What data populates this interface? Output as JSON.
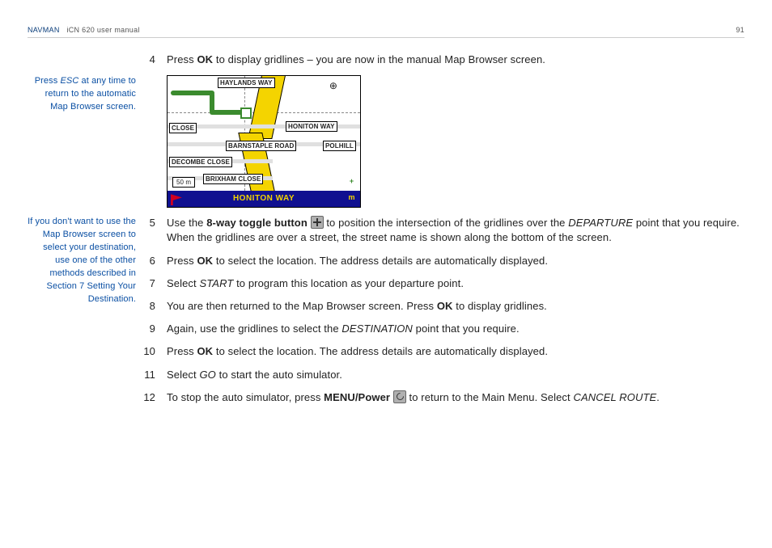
{
  "header": {
    "brand": "NAVMAN",
    "doc": "iCN 620 user manual",
    "page": "91"
  },
  "sidenotes": {
    "esc": {
      "pre": "Press ",
      "key": "ESC",
      "post": " at any time to return to the automatic Map Browser screen."
    },
    "alt": "If you don't want to use the Map Browser screen to select your destination, use one of the other methods described in Section 7 Setting Your Destination."
  },
  "map": {
    "streets": {
      "haylands": "HAYLANDS WAY",
      "honiton_way_upper": "HONITON WAY",
      "close": "CLOSE",
      "barnstaple": "BARNSTAPLE ROAD",
      "polhill": "POLHILL",
      "decombe": "DECOMBE CLOSE",
      "brixham": "BRIXHAM CLOSE"
    },
    "scale": "50 m",
    "footer": "HONITON WAY",
    "zoom_unit": "m"
  },
  "steps": {
    "s4": {
      "n": "4",
      "pre": "Press ",
      "b1": "OK",
      "post": " to display gridlines – you are now in the manual Map Browser screen."
    },
    "s5": {
      "n": "5",
      "pre": "Use the ",
      "b1": "8-way toggle button",
      "mid": " to position the intersection of the gridlines over the ",
      "i1": "DEPARTURE",
      "post": " point that you require. When the gridlines are over a street, the street name is shown along the bottom of the screen."
    },
    "s6": {
      "n": "6",
      "pre": "Press ",
      "b1": "OK",
      "post": " to select the location. The address details are automatically displayed."
    },
    "s7": {
      "n": "7",
      "pre": "Select ",
      "i1": "START",
      "post": " to program this location as your departure point."
    },
    "s8": {
      "n": "8",
      "pre": "You are then returned to the Map Browser screen. Press ",
      "b1": "OK",
      "post": " to display gridlines."
    },
    "s9": {
      "n": "9",
      "pre": "Again, use the gridlines to select the ",
      "i1": "DESTINATION",
      "post": " point that you require."
    },
    "s10": {
      "n": "10",
      "pre": "Press ",
      "b1": "OK",
      "post": " to select the location. The address details are automatically displayed."
    },
    "s11": {
      "n": "11",
      "pre": "Select ",
      "i1": "GO",
      "post": " to start the auto simulator."
    },
    "s12": {
      "n": "12",
      "pre": "To stop the auto simulator, press ",
      "b1": "MENU/Power",
      "mid": " to return to the Main Menu. Select ",
      "i1": "CANCEL ROUTE",
      "post": "."
    }
  }
}
